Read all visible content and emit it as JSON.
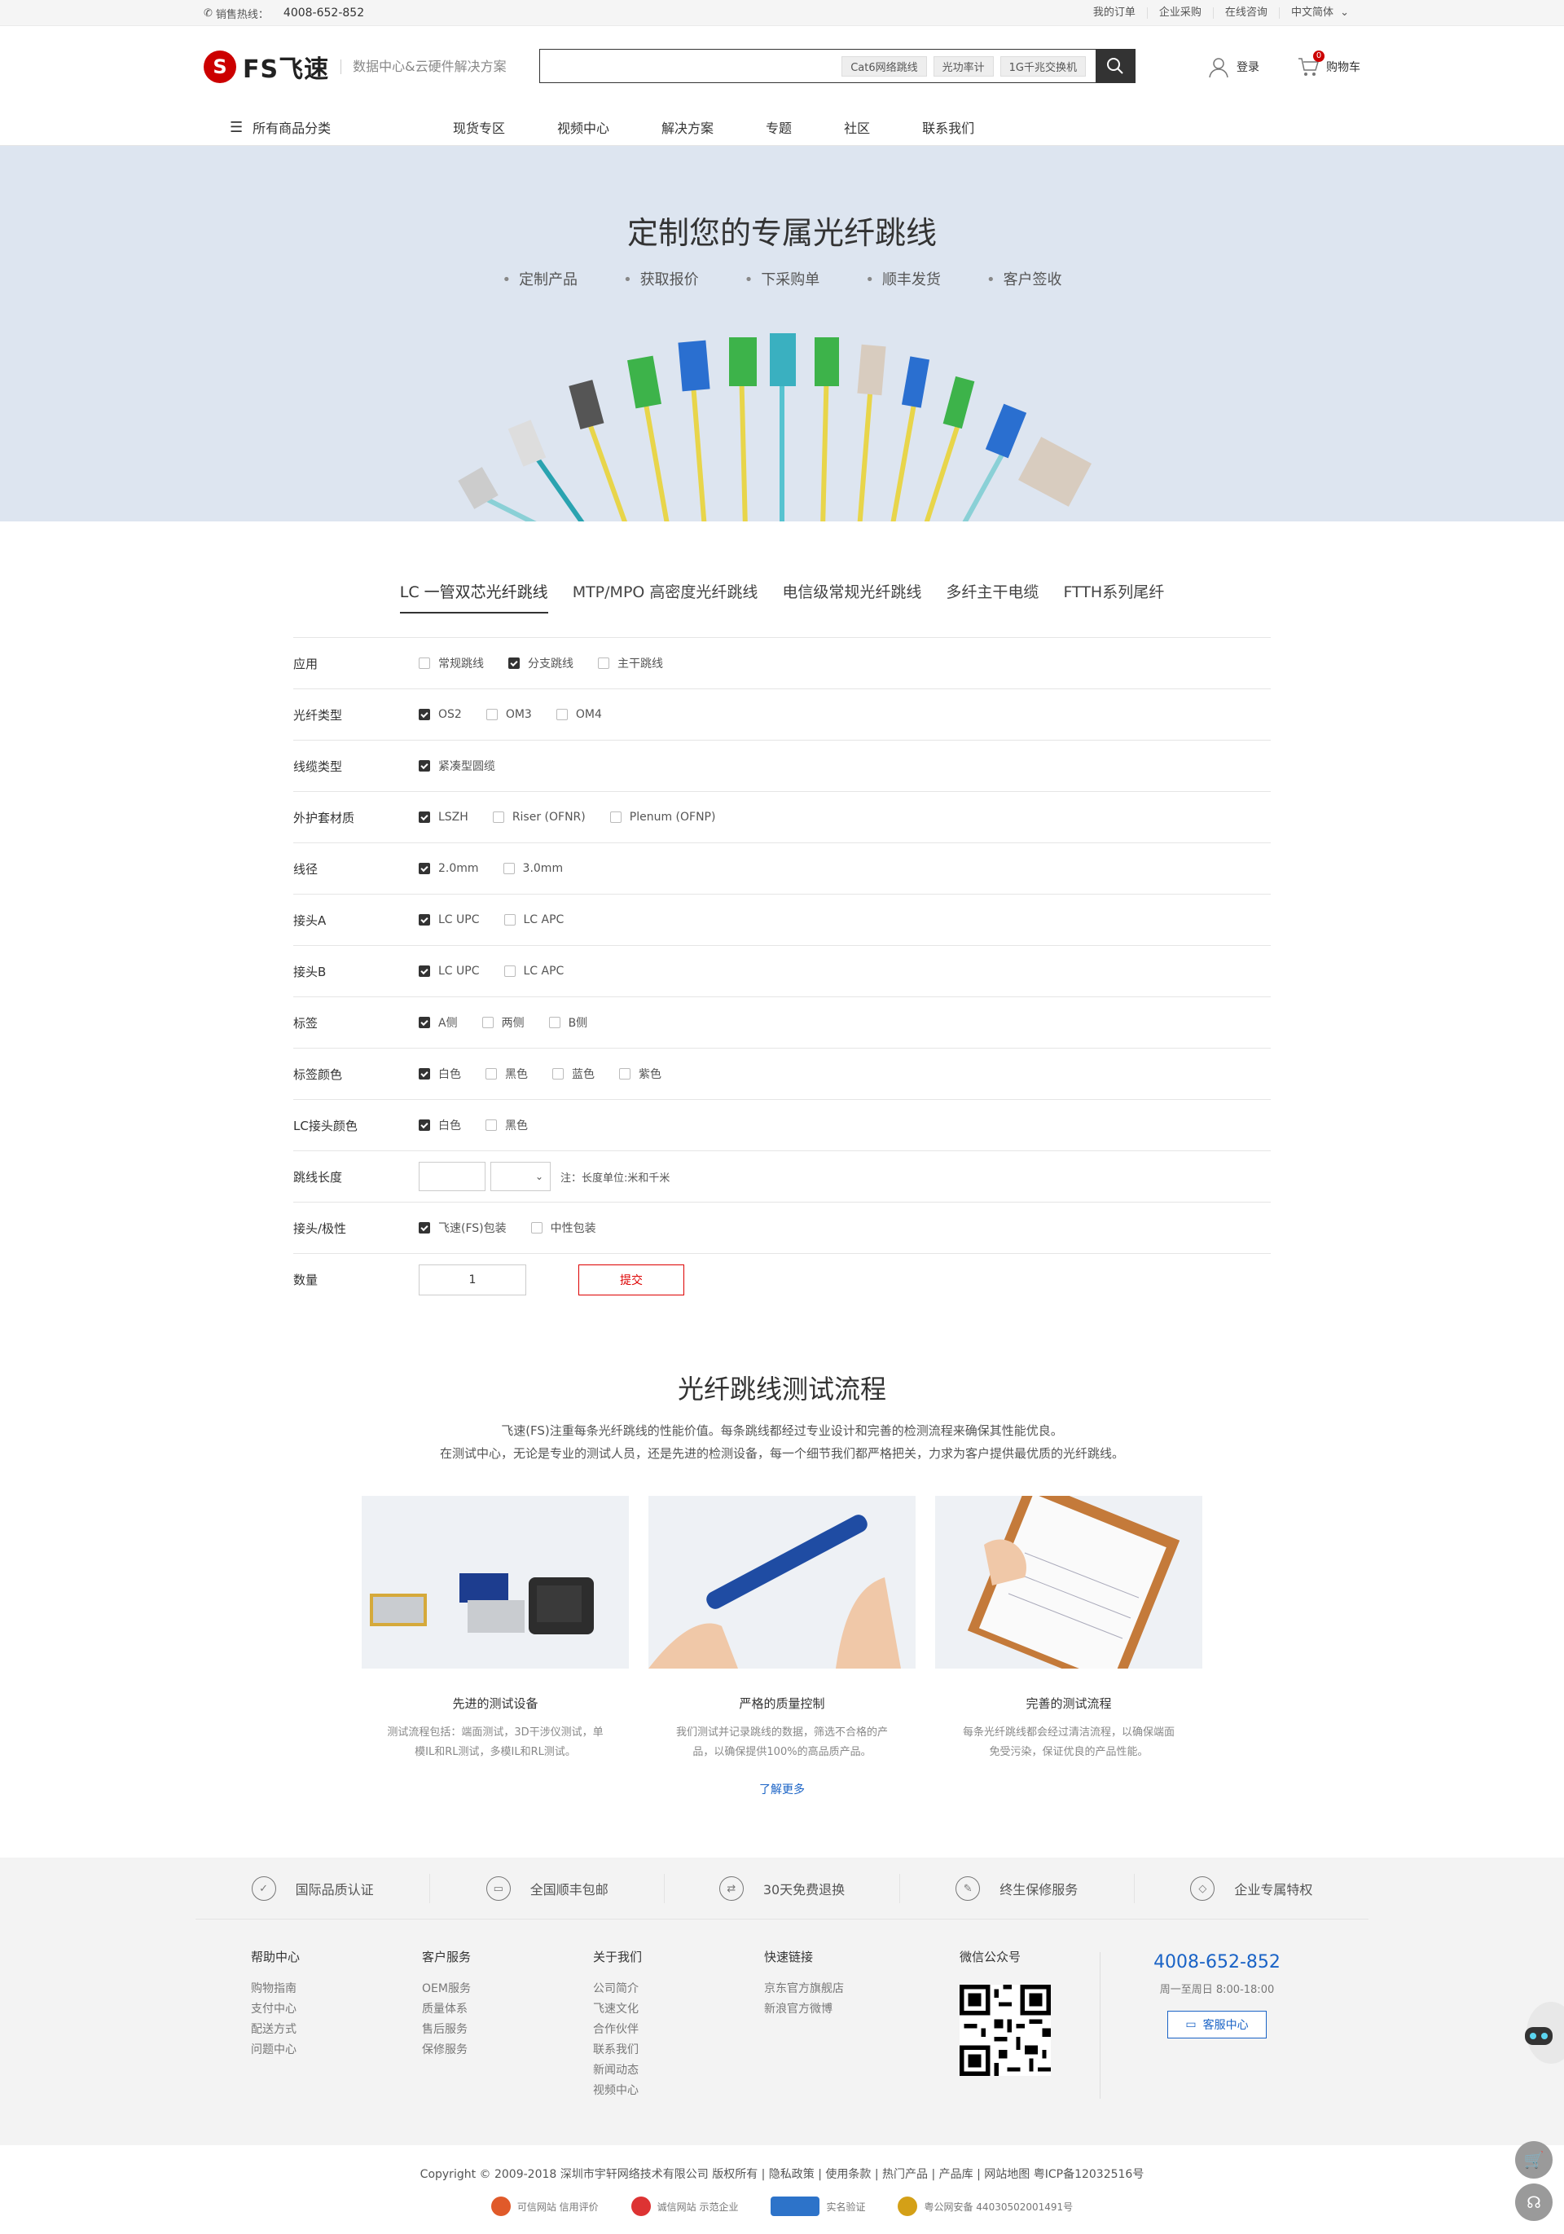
{
  "topbar": {
    "hotline_label": "销售热线：",
    "hotline_number": "4008-652-852",
    "links": [
      "我的订单",
      "企业采购",
      "在线咨询",
      "中文简体"
    ]
  },
  "header": {
    "logo_text": "FS飞速",
    "slogan": "数据中心&云硬件解决方案",
    "search_tags": [
      "Cat6网络跳线",
      "光功率计",
      "1G千兆交换机"
    ],
    "login_label": "登录",
    "cart_label": "购物车",
    "cart_count": "0"
  },
  "nav": {
    "all_label": "所有商品分类",
    "items": [
      "现货专区",
      "视频中心",
      "解决方案",
      "专题",
      "社区",
      "联系我们"
    ]
  },
  "hero": {
    "title": "定制您的专属光纤跳线",
    "steps": [
      "定制产品",
      "获取报价",
      "下采购单",
      "顺丰发货",
      "客户签收"
    ]
  },
  "tabs": [
    "LC 一管双芯光纤跳线",
    "MTP/MPO 高密度光纤跳线",
    "电信级常规光纤跳线",
    "多纤主干电缆",
    "FTTH系列尾纤"
  ],
  "form": {
    "rows": [
      {
        "label": "应用",
        "options": [
          {
            "text": "常规跳线",
            "checked": false
          },
          {
            "text": "分支跳线",
            "checked": true
          },
          {
            "text": "主干跳线",
            "checked": false
          }
        ]
      },
      {
        "label": "光纤类型",
        "options": [
          {
            "text": "OS2",
            "checked": true
          },
          {
            "text": "OM3",
            "checked": false
          },
          {
            "text": "OM4",
            "checked": false
          }
        ]
      },
      {
        "label": "线缆类型",
        "options": [
          {
            "text": "紧凑型圆缆",
            "checked": true
          }
        ]
      },
      {
        "label": "外护套材质",
        "options": [
          {
            "text": "LSZH",
            "checked": true
          },
          {
            "text": "Riser (OFNR)",
            "checked": false
          },
          {
            "text": "Plenum (OFNP)",
            "checked": false
          }
        ]
      },
      {
        "label": "线径",
        "options": [
          {
            "text": "2.0mm",
            "checked": true
          },
          {
            "text": "3.0mm",
            "checked": false
          }
        ]
      },
      {
        "label": "接头A",
        "options": [
          {
            "text": "LC UPC",
            "checked": true
          },
          {
            "text": "LC APC",
            "checked": false
          }
        ]
      },
      {
        "label": "接头B",
        "options": [
          {
            "text": "LC UPC",
            "checked": true
          },
          {
            "text": "LC APC",
            "checked": false
          }
        ]
      },
      {
        "label": "标签",
        "options": [
          {
            "text": "A侧",
            "checked": true
          },
          {
            "text": "两侧",
            "checked": false
          },
          {
            "text": "B侧",
            "checked": false
          }
        ]
      },
      {
        "label": "标签颜色",
        "options": [
          {
            "text": "白色",
            "checked": true
          },
          {
            "text": "黑色",
            "checked": false
          },
          {
            "text": "蓝色",
            "checked": false
          },
          {
            "text": "紫色",
            "checked": false
          }
        ]
      },
      {
        "label": "LC接头颜色",
        "options": [
          {
            "text": "白色",
            "checked": true
          },
          {
            "text": "黑色",
            "checked": false
          }
        ]
      }
    ],
    "length_label": "跳线长度",
    "length_note": "注：长度单位:米和千米",
    "package_label": "接头/极性",
    "package_options": [
      {
        "text": "飞速(FS)包装",
        "checked": true
      },
      {
        "text": "中性包装",
        "checked": false
      }
    ],
    "qty_label": "数量",
    "qty_value": "1",
    "submit_label": "提交"
  },
  "testing": {
    "title": "光纤跳线测试流程",
    "desc_line1": "飞速(FS)注重每条光纤跳线的性能价值。每条跳线都经过专业设计和完善的检测流程来确保其性能优良。",
    "desc_line2": "在测试中心，无论是专业的测试人员，还是先进的检测设备，每一个细节我们都严格把关，力求为客户提供最优质的光纤跳线。",
    "cards": [
      {
        "title": "先进的测试设备",
        "text": "测试流程包括：端面测试，3D干涉仪测试，单模IL和RL测试，多模IL和RL测试。"
      },
      {
        "title": "严格的质量控制",
        "text": "我们测试并记录跳线的数据，筛选不合格的产品，以确保提供100%的高品质产品。"
      },
      {
        "title": "完善的测试流程",
        "text": "每条光纤跳线都会经过清洁流程，以确保端面免受污染，保证优良的产品性能。"
      }
    ],
    "more_label": "了解更多"
  },
  "footer": {
    "services": [
      "国际品质认证",
      "全国顺丰包邮",
      "30天免费退换",
      "终生保修服务",
      "企业专属特权"
    ],
    "columns": [
      {
        "title": "帮助中心",
        "links": [
          "购物指南",
          "支付中心",
          "配送方式",
          "问题中心"
        ]
      },
      {
        "title": "客户服务",
        "links": [
          "OEM服务",
          "质量体系",
          "售后服务",
          "保修服务"
        ]
      },
      {
        "title": "关于我们",
        "links": [
          "公司简介",
          "飞速文化",
          "合作伙伴",
          "联系我们",
          "新闻动态",
          "视频中心"
        ]
      },
      {
        "title": "快速链接",
        "links": [
          "京东官方旗舰店",
          "新浪官方微博"
        ]
      }
    ],
    "wechat_title": "微信公众号",
    "phone": "4008-652-852",
    "hours": "周一至周日 8:00-18:00",
    "cs_label": "客服中心",
    "copyright": "Copyright © 2009-2018 深圳市宇轩网络技术有限公司 版权所有 | 隐私政策 | 使用条款 | 热门产品 | 产品库 | 网站地图   粤ICP备12032516号",
    "badges": [
      "可信网站 信用评价",
      "诚信网站 示范企业",
      "实名验证",
      "粤公网安备 44030502001491号"
    ]
  },
  "colors": {
    "accent": "#1a63c6",
    "brand": "#cc0000",
    "hero_bg": "#dde5f0"
  }
}
